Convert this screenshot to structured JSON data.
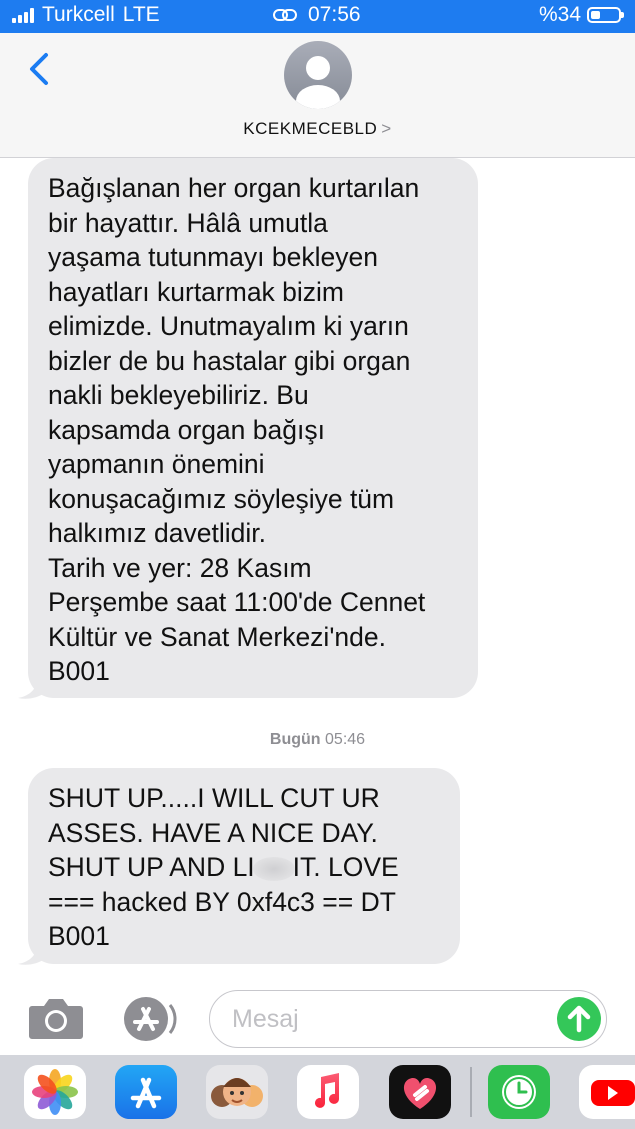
{
  "status_bar": {
    "carrier": "Turkcell",
    "network": "LTE",
    "time": "07:56",
    "battery": "%34",
    "battery_level": 0.34
  },
  "header": {
    "contact_name": "KCEKMECEBLD",
    "contact_chevron": ">"
  },
  "messages": [
    {
      "lines": [
        "Bağışlanan her organ kurtarılan",
        "bir hayattır. Hâlâ umutla",
        "yaşama tutunmayı bekleyen",
        "hayatları kurtarmak bizim",
        "elimizde. Unutmayalım ki yarın",
        "bizler de bu hastalar gibi organ",
        "nakli bekleyebiliriz. Bu",
        "kapsamda organ bağışı",
        "yapmanın önemini",
        "konuşacağımız söyleşiye tüm",
        "halkımız davetlidir.",
        "Tarih ve yer: 28 Kasım",
        "Perşembe saat 11:00'de Cennet",
        "Kültür ve Sanat Merkezi'nde.",
        "B001"
      ]
    },
    {
      "timestamp_day": "Bugün",
      "timestamp_time": "05:46",
      "lines": [
        "SHUT UP.....I WILL CUT UR",
        "ASSES. HAVE A NICE DAY.",
        "SHUT UP AND LI",
        "IT. LOVE",
        "=== hacked BY 0xf4c3 == DT",
        "B001"
      ]
    }
  ],
  "input_bar": {
    "placeholder": "Mesaj",
    "camera_icon": "camera-icon",
    "appstore_icon": "app-store-icon",
    "send_icon": "send-arrow-icon"
  },
  "dock": {
    "apps": [
      "photos-icon",
      "app-store-icon",
      "memoji-icon",
      "music-icon",
      "heart-app-icon",
      "clock-icon",
      "youtube-icon"
    ]
  },
  "colors": {
    "status_bar": "#1e7cf0",
    "bubble": "#e9e9eb",
    "send": "#34c759",
    "accent": "#1b7cf2"
  }
}
